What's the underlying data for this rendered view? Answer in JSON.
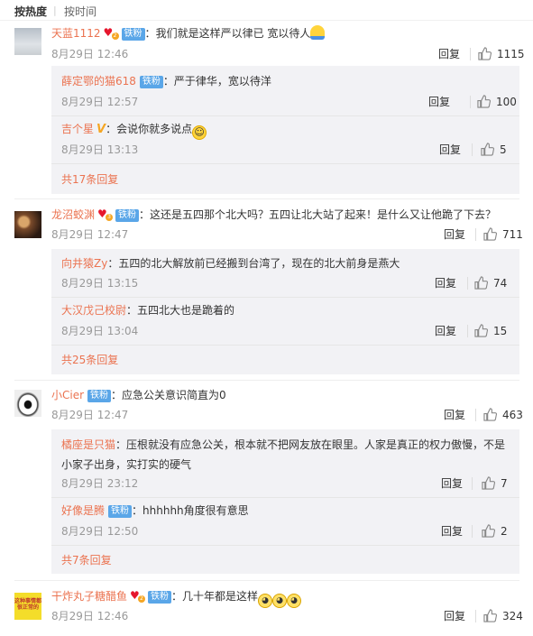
{
  "tabs": {
    "hot": "按热度",
    "time": "按时间",
    "sep": "|"
  },
  "comments": [
    {
      "user": "天蓝1112",
      "badge": "铁粉",
      "text": "我们就是这样严以律已 宽以待人",
      "time": "8月29日 12:46",
      "reply": "回复",
      "likes": "1115",
      "replies": [
        {
          "user": "薛定鄂的猫618",
          "badge": "铁粉",
          "text": "严于律华，宽以待洋",
          "time": "8月29日 12:57",
          "reply": "回复",
          "likes": "100"
        },
        {
          "user": "吉个星",
          "badge": "",
          "vbadge": "V",
          "text": "会说你就多说点",
          "time": "8月29日 13:13",
          "reply": "回复",
          "likes": "5"
        }
      ],
      "more": "共17条回复"
    },
    {
      "user": "龙沼蛟渊",
      "badge": "铁粉",
      "text": "这还是五四那个北大吗？五四让北大站了起来！是什么又让他跪了下去？",
      "time": "8月29日 12:47",
      "reply": "回复",
      "likes": "711",
      "replies": [
        {
          "user": "向井猿Zy",
          "badge": "",
          "text": "五四的北大解放前已经搬到台湾了，现在的北大前身是燕大",
          "time": "8月29日 13:15",
          "reply": "回复",
          "likes": "74"
        },
        {
          "user": "大汉戊己校尉",
          "badge": "",
          "text": "五四北大也是跪着的",
          "time": "8月29日 13:04",
          "reply": "回复",
          "likes": "15"
        }
      ],
      "more": "共25条回复"
    },
    {
      "user": "小Cier",
      "badge": "铁粉",
      "text": "应急公关意识简直为0",
      "time": "8月29日 12:47",
      "reply": "回复",
      "likes": "463",
      "replies": [
        {
          "user": "橘座是只猫",
          "badge": "",
          "text": "压根就没有应急公关，根本就不把网友放在眼里。人家是真正的权力傲慢，不是",
          "text2": "小家子出身，实打实的硬气",
          "time": "8月29日 23:12",
          "reply": "回复",
          "likes": "7"
        },
        {
          "user": "好像是腾",
          "badge": "铁粉",
          "text": "hhhhhh角度很有意思",
          "time": "8月29日 12:50",
          "reply": "回复",
          "likes": "2"
        }
      ],
      "more": "共7条回复"
    },
    {
      "user": "干炸丸子糖醋鱼",
      "badge": "铁粉",
      "text": "几十年都是这样",
      "time": "8月29日 12:46",
      "reply": "回复",
      "likes": "324",
      "avatar_text": "这种事情都很正常的"
    }
  ],
  "icons": {
    "thumb": "thumb-up-icon",
    "vip": "heart-vip-icon"
  },
  "colors": {
    "username": "#eb7350",
    "badge": "#5aa6e8",
    "subbox": "#f2f2f5",
    "muted": "#999999"
  }
}
